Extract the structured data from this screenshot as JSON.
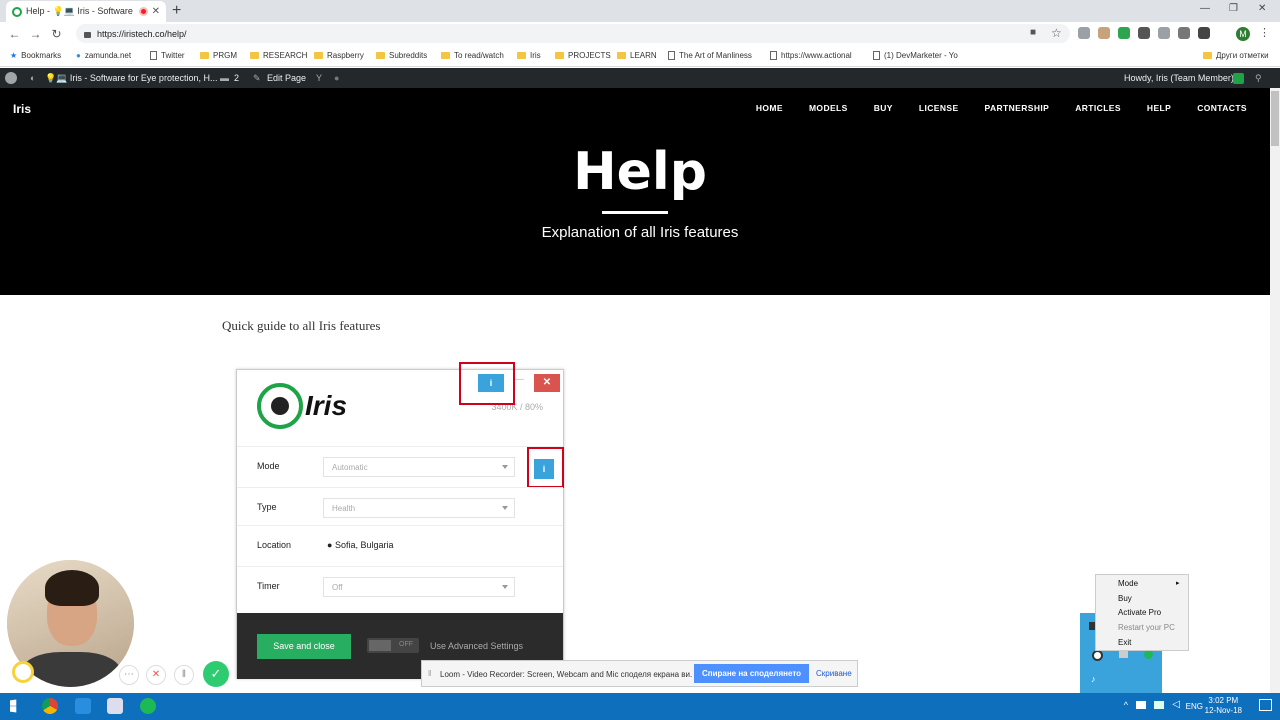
{
  "browser": {
    "tab_title": "Help - 💡💻 Iris - Software f",
    "tab_close": "✕",
    "new_tab": "+",
    "url": "https://iristech.co/help/",
    "win_min": "—",
    "win_max": "❐",
    "win_close": "✕",
    "profile_initial": "M"
  },
  "bookmarks": [
    "Bookmarks",
    "zamunda.net",
    "Twitter",
    "PRGM",
    "RESEARCH",
    "Raspberry",
    "Subreddits",
    "To read/watch",
    "Iris",
    "PROJECTS",
    "LEARN",
    "The Art of Manliness",
    "https://www.actional",
    "(1) DevMarketer - Yo",
    "Други отметки"
  ],
  "wpbar": {
    "site": "💡💻 Iris - Software for Eye protection, H...",
    "comments": "2",
    "edit": "Edit Page",
    "howdy": "Howdy, Iris (Team Member)"
  },
  "site": {
    "brand": "Iris",
    "menu": [
      "HOME",
      "MODELS",
      "BUY",
      "LICENSE",
      "PARTNERSHIP",
      "ARTICLES",
      "HELP",
      "CONTACTS"
    ],
    "title": "Help",
    "subtitle": "Explanation of all Iris features",
    "section": "Quick guide to all Iris features"
  },
  "iris_app": {
    "name": "Iris",
    "temp": "3400K / 80%",
    "info": "i",
    "min": "—",
    "close": "✕",
    "mode_label": "Mode",
    "mode_value": "Automatic",
    "type_label": "Type",
    "type_value": "Health",
    "location_label": "Location",
    "location_value": "Sofia, Bulgaria",
    "timer_label": "Timer",
    "timer_value": "Off",
    "save": "Save and close",
    "toggle": "OFF",
    "advanced": "Use Advanced Settings"
  },
  "sharebar": {
    "text": "Loom - Video Recorder: Screen, Webcam and Mic споделя екрана ви.",
    "stop": "Спиране на споделянето",
    "hide": "Скриване"
  },
  "tray_menu": [
    "Mode",
    "Buy",
    "Activate Pro",
    "Restart your PC",
    "Exit"
  ],
  "taskbar": {
    "lang": "ENG",
    "time": "3:02 PM",
    "date": "12-Nov-18"
  },
  "colors": {
    "accent_green": "#27ae60",
    "info_blue": "#3ba3dc",
    "close_red": "#d9534f",
    "highlight_red": "#d0021b"
  }
}
